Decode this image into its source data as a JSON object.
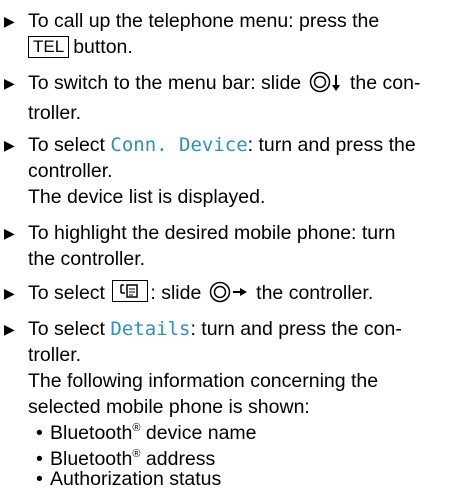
{
  "steps": [
    {
      "pre": "To call up the telephone menu: press the",
      "key": "TEL",
      "post": "button."
    },
    {
      "pre": "To switch to the menu bar: slide",
      "post1": "the con-",
      "line2": "troller."
    },
    {
      "pre": "To select",
      "highlight": "Conn. Device",
      "post": ": turn and press the",
      "line2": "controller.",
      "result": "The device list is displayed."
    },
    {
      "line1": "To highlight the desired mobile phone: turn",
      "line2": "the controller."
    },
    {
      "pre": "To select",
      "mid": ": slide",
      "post": "the controller."
    },
    {
      "pre": "To select",
      "highlight": "Details",
      "post": ": turn and press the con-",
      "line2": "troller.",
      "result1": "The following information concerning the",
      "result2": "selected mobile phone is shown:"
    }
  ],
  "bullets": [
    {
      "pre": "Bluetooth",
      "sup": "®",
      "post": " device name"
    },
    {
      "pre": "Bluetooth",
      "sup": "®",
      "post": " address"
    },
    {
      "text": "Authorization status"
    }
  ],
  "icons": {
    "step_marker": "triangle-right-icon",
    "controller": "controller-knob-icon",
    "phonebook": "phonebook-icon"
  },
  "colors": {
    "highlight": "#2f8fc4",
    "text": "#000000"
  }
}
